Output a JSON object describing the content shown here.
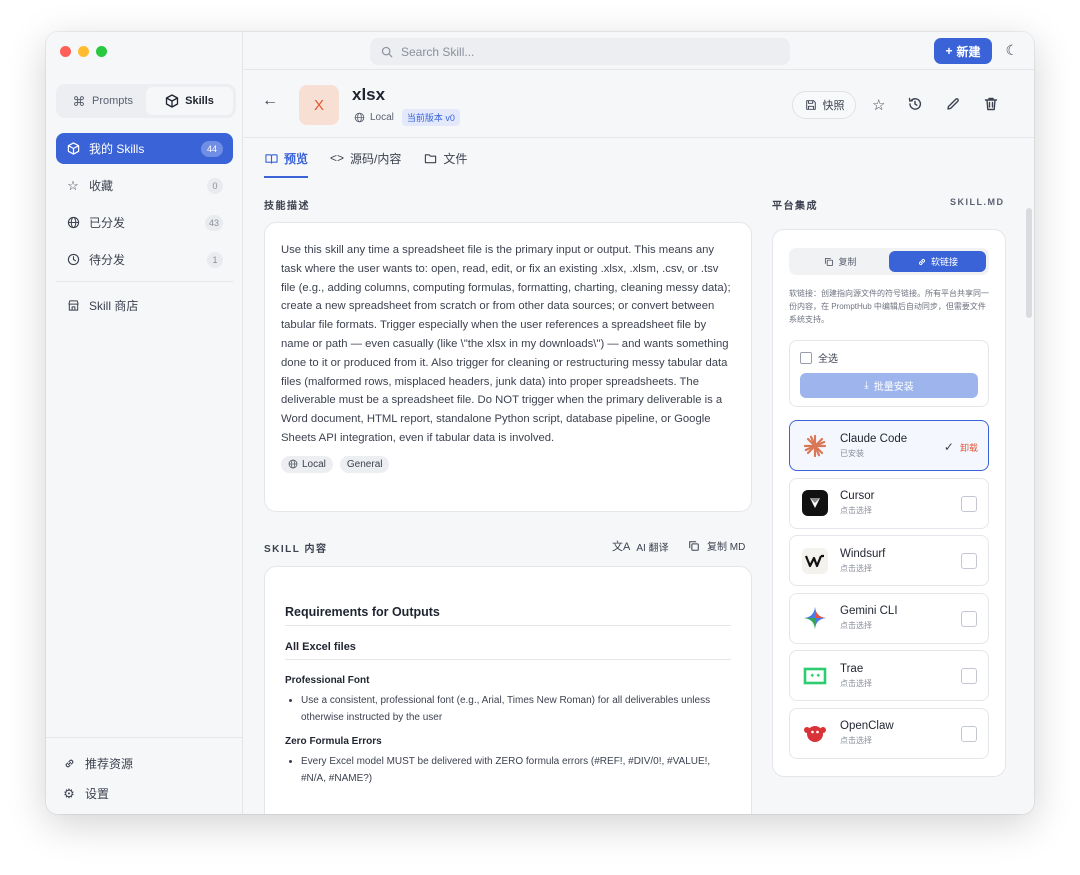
{
  "app": {
    "search_placeholder": "Search Skill...",
    "new_label": "新建"
  },
  "sidebar": {
    "segments": [
      {
        "label": "Prompts",
        "active": false
      },
      {
        "label": "Skills",
        "active": true
      }
    ],
    "items": [
      {
        "label": "我的 Skills",
        "count": "44",
        "active": true
      },
      {
        "label": "收藏",
        "count": "0"
      },
      {
        "label": "已分发",
        "count": "43"
      },
      {
        "label": "待分发",
        "count": "1"
      },
      {
        "label": "Skill 商店"
      }
    ],
    "bottom": [
      {
        "label": "推荐资源"
      },
      {
        "label": "设置"
      }
    ]
  },
  "header": {
    "icon_letter": "X",
    "title": "xlsx",
    "source": "Local",
    "version": "当前版本 v0",
    "snapshot_label": "快照"
  },
  "tabs": [
    {
      "label": "预览",
      "active": true
    },
    {
      "label": "源码/内容"
    },
    {
      "label": "文件"
    }
  ],
  "description": {
    "section_title": "技能描述",
    "text": "Use this skill any time a spreadsheet file is the primary input or output. This means any task where the user wants to: open, read, edit, or fix an existing .xlsx, .xlsm, .csv, or .tsv file (e.g., adding columns, computing formulas, formatting, charting, cleaning messy data); create a new spreadsheet from scratch or from other data sources; or convert between tabular file formats. Trigger especially when the user references a spreadsheet file by name or path — even casually (like \\\"the xlsx in my downloads\\\") — and wants something done to it or produced from it. Also trigger for cleaning or restructuring messy tabular data files (malformed rows, misplaced headers, junk data) into proper spreadsheets. The deliverable must be a spreadsheet file. Do NOT trigger when the primary deliverable is a Word document, HTML report, standalone Python script, database pipeline, or Google Sheets API integration, even if tabular data is involved.",
    "tags": [
      "Local",
      "General"
    ]
  },
  "skill_content": {
    "section_title": "SKILL 内容",
    "translate_label": "AI 翻译",
    "copy_md_label": "复制 MD",
    "h_outputs": "Requirements for Outputs",
    "h_excel": "All Excel files",
    "h_font": "Professional Font",
    "font_item": "Use a consistent, professional font (e.g., Arial, Times New Roman) for all deliverables unless otherwise instructed by the user",
    "h_zero": "Zero Formula Errors",
    "zero_item": "Every Excel model MUST be delivered with ZERO formula errors (#REF!, #DIV/0!, #VALUE!, #N/A, #NAME?)"
  },
  "platform": {
    "section_title": "平台集成",
    "section_right": "SKILL.MD",
    "copy_label": "复制",
    "link_label": "软链接",
    "note": "软链接：创建指向源文件的符号链接。所有平台共享同一份内容，在 PromptHub 中编辑后自动同步，但需要文件系统支持。",
    "select_all": "全选",
    "batch_install": "批量安装",
    "uninstall_label": "卸载",
    "items": [
      {
        "name": "Claude Code",
        "status": "已安装",
        "installed": true,
        "color": "#d97757"
      },
      {
        "name": "Cursor",
        "status": "点击选择",
        "color": "#111111"
      },
      {
        "name": "Windsurf",
        "status": "点击选择",
        "color": "#111111"
      },
      {
        "name": "Gemini CLI",
        "status": "点击选择",
        "color": "#4a7be8"
      },
      {
        "name": "Trae",
        "status": "点击选择",
        "color": "#2ecc71"
      },
      {
        "name": "OpenClaw",
        "status": "点击选择",
        "color": "#d9333a"
      }
    ]
  }
}
